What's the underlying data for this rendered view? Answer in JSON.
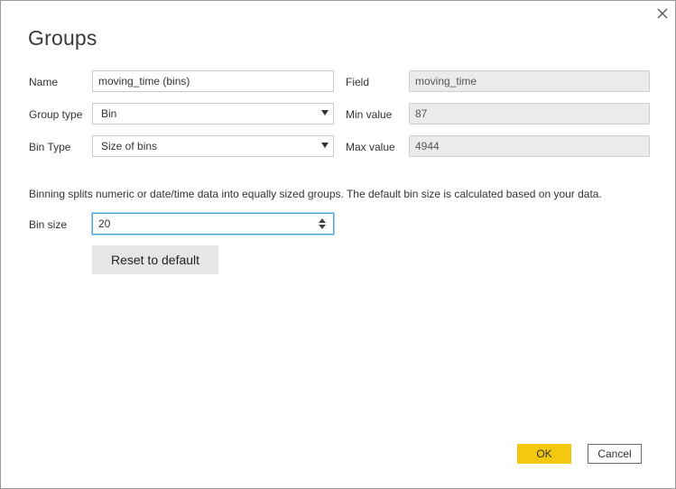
{
  "dialog": {
    "title": "Groups"
  },
  "form": {
    "name_label": "Name",
    "name_value": "moving_time (bins)",
    "group_type_label": "Group type",
    "group_type_value": "Bin",
    "bin_type_label": "Bin Type",
    "bin_type_value": "Size of bins",
    "field_label": "Field",
    "field_value": "moving_time",
    "min_label": "Min value",
    "min_value": "87",
    "max_label": "Max value",
    "max_value": "4944",
    "info_text": "Binning splits numeric or date/time data into equally sized groups. The default bin size is calculated based on your data.",
    "bin_size_label": "Bin size",
    "bin_size_value": "20",
    "reset_label": "Reset to default"
  },
  "footer": {
    "ok_label": "OK",
    "cancel_label": "Cancel"
  },
  "colors": {
    "accent": "#f2c811",
    "focus": "#44a2d9",
    "readonly_bg": "#ebebeb"
  },
  "icons": {
    "close": "close-icon",
    "dropdown": "chevron-down-icon",
    "spinner": "spinner-arrows-icon"
  }
}
